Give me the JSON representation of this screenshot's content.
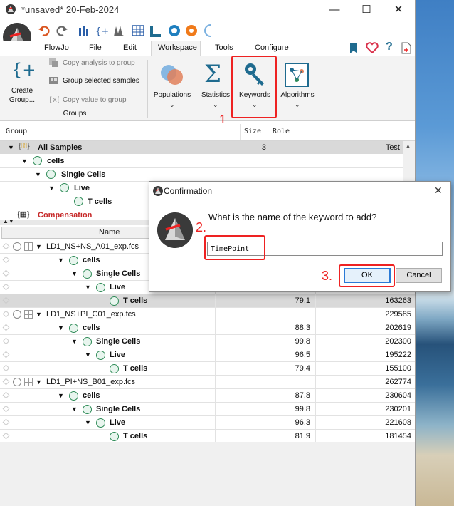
{
  "window": {
    "title": "*unsaved* 20-Feb-2024",
    "minimize": "—",
    "maximize": "☐",
    "close": "✕"
  },
  "quick_toolbar": {
    "icons": [
      "undo-icon",
      "redo-icon",
      "compensation-icon",
      "bracket-icon",
      "chart-icon",
      "table-icon",
      "layout-icon",
      "gauge-icon",
      "sun-icon",
      "crescent-icon"
    ]
  },
  "menu": {
    "items": [
      "FlowJo",
      "File",
      "Edit",
      "Workspace",
      "Tools",
      "Configure"
    ],
    "active": "Workspace"
  },
  "ribbon": {
    "create_group": "Create Group...",
    "copy_analysis": "Copy analysis to group",
    "group_selected": "Group selected samples",
    "copy_value": "Copy value to group",
    "groups_section": "Groups",
    "populations": "Populations",
    "statistics": "Statistics",
    "keywords": "Keywords",
    "algorithms": "Algorithms"
  },
  "groups_table": {
    "headers": [
      "Group",
      "Size",
      "Role"
    ],
    "rows": [
      {
        "label": "All Samples",
        "size": "3",
        "role": "Test"
      },
      {
        "label": "cells"
      },
      {
        "label": "Single Cells"
      },
      {
        "label": "Live"
      },
      {
        "label": "T cells"
      },
      {
        "label": "Compensation"
      }
    ]
  },
  "samples_table": {
    "name_header": "Name",
    "rows": [
      {
        "name": "LD1_NS+NS_A01_exp.fcs",
        "pct": "",
        "count": ""
      },
      {
        "name": "cells",
        "pct": "",
        "count": ""
      },
      {
        "name": "Single Cells",
        "pct": "",
        "count": ""
      },
      {
        "name": "Live",
        "pct": "",
        "count": ""
      },
      {
        "name": "T cells",
        "pct": "79.1",
        "count": "163263"
      },
      {
        "name": "LD1_NS+PI_C01_exp.fcs",
        "pct": "",
        "count": "229585"
      },
      {
        "name": "cells",
        "pct": "88.3",
        "count": "202619"
      },
      {
        "name": "Single Cells",
        "pct": "99.8",
        "count": "202300"
      },
      {
        "name": "Live",
        "pct": "96.5",
        "count": "195222"
      },
      {
        "name": "T cells",
        "pct": "79.4",
        "count": "155100"
      },
      {
        "name": "LD1_PI+NS_B01_exp.fcs",
        "pct": "",
        "count": "262774"
      },
      {
        "name": "cells",
        "pct": "87.8",
        "count": "230604"
      },
      {
        "name": "Single Cells",
        "pct": "99.8",
        "count": "230201"
      },
      {
        "name": "Live",
        "pct": "96.3",
        "count": "221608"
      },
      {
        "name": "T cells",
        "pct": "81.9",
        "count": "181454"
      }
    ]
  },
  "dialog": {
    "title": "Confirmation",
    "question": "What is the name of the keyword to add?",
    "input_value": "TimePoint",
    "ok": "OK",
    "cancel": "Cancel"
  },
  "annotations": {
    "step1": "1.",
    "step2": "2.",
    "step3": "3.",
    "color": "#e22222"
  }
}
